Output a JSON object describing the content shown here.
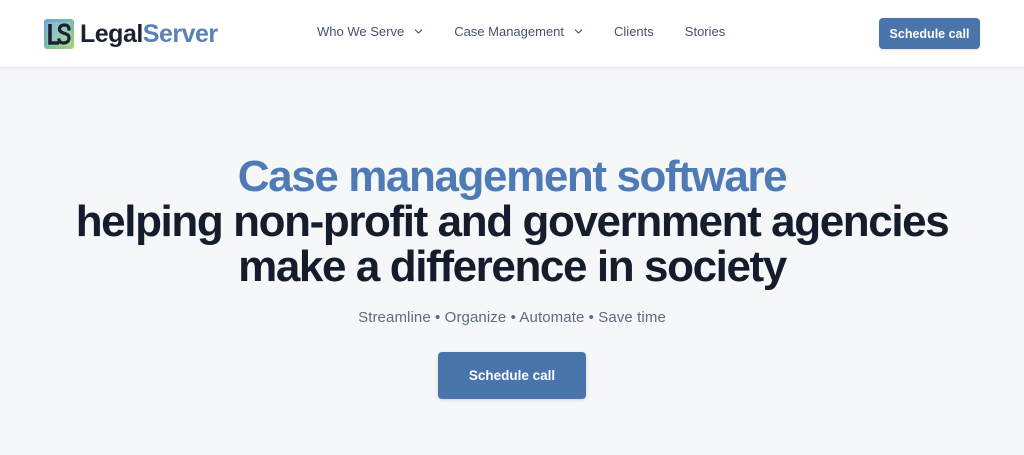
{
  "header": {
    "brand": {
      "name_part_1": "Legal",
      "name_part_2": "Server",
      "logo_icon": "ls-monogram-icon"
    },
    "nav": [
      {
        "label": "Who We Serve",
        "has_dropdown": true,
        "icon": "chevron-down-icon"
      },
      {
        "label": "Case Management",
        "has_dropdown": true,
        "icon": "chevron-down-icon"
      },
      {
        "label": "Clients",
        "has_dropdown": false
      },
      {
        "label": "Stories",
        "has_dropdown": false
      }
    ],
    "cta_label": "Schedule call"
  },
  "hero": {
    "title_accent": "Case management software",
    "title_line_2": "helping non-profit and government agencies",
    "title_line_3": "make a difference in society",
    "tagline": "Streamline • Organize • Automate • Save time",
    "cta_label": "Schedule call"
  },
  "colors": {
    "accent": "#4e7bb6",
    "button": "#4a74ac",
    "heading": "#151c2c",
    "body_text": "#5e6a80",
    "nav_text": "#45546d",
    "page_background": "#f6f7f9",
    "header_background": "#ffffff"
  }
}
